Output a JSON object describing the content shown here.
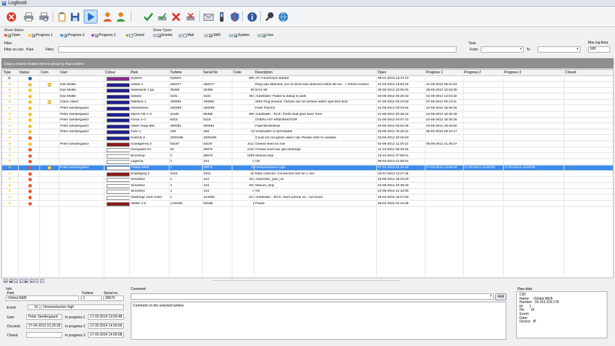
{
  "window": {
    "title": "Logbook"
  },
  "toolbar": {
    "buttons": [
      {
        "name": "close-icon",
        "color": "#d9342b"
      },
      {
        "name": "print-icon",
        "color": "#6b7380"
      },
      {
        "name": "print-preview-icon",
        "color": "#6b7380"
      },
      {
        "name": "clipboard-icon",
        "color": "#c8932b"
      },
      {
        "name": "save-icon",
        "color": "#2c5aa0"
      },
      {
        "name": "play-icon",
        "color": "#1f6fd1"
      },
      {
        "name": "user-icon",
        "color": "#e0892b"
      },
      {
        "name": "user-add-icon",
        "color": "#e0892b"
      },
      {
        "name": "acknowledge-check-icon",
        "color": "#2ba33a"
      },
      {
        "name": "acknowledge-all-icon",
        "color": "#6b7380"
      },
      {
        "name": "delete-x-icon",
        "color": "#d9342b"
      },
      {
        "name": "delete-all-icon",
        "color": "#6b7380"
      },
      {
        "name": "mail-icon",
        "color": "#6b7380"
      },
      {
        "name": "phone-icon",
        "color": "#3a3f47"
      },
      {
        "name": "shield-icon",
        "color": "#2c6fc7"
      },
      {
        "name": "info-icon",
        "color": "#2c5aa0"
      },
      {
        "name": "wrench-icon",
        "color": "#3a3f47"
      },
      {
        "name": "globe-icon",
        "color": "#2c7fc7"
      }
    ]
  },
  "show_status": {
    "title": "Show Status",
    "items": [
      {
        "label": "Open",
        "checked": true,
        "color": "#e8562a"
      },
      {
        "label": "Progress 1",
        "checked": true,
        "color": "#f2c12e"
      },
      {
        "label": "Progress 2",
        "checked": true,
        "color": "#3a8ee0"
      },
      {
        "label": "Progress 3",
        "checked": true,
        "color": "#a04fc8"
      },
      {
        "label": "Closed",
        "checked": false,
        "color": "#7bc043"
      }
    ]
  },
  "show_types": {
    "title": "Show Types",
    "items": [
      {
        "label": "Events",
        "checked": true
      },
      {
        "label": "Mail",
        "checked": false
      },
      {
        "label": "SMS",
        "checked": true
      },
      {
        "label": "System",
        "checked": true
      },
      {
        "label": "User",
        "checked": true
      }
    ]
  },
  "filter": {
    "title": "Filter",
    "on_row_label": "Filter on row:",
    "on_row_value": "Park",
    "filter_label": "Filter:",
    "filter_value": ""
  },
  "time": {
    "title": "Time",
    "from_label": "From",
    "from_value": "",
    "to_label": "To",
    "to_value": ""
  },
  "max_log": {
    "label": "Max log lines",
    "value": "500"
  },
  "group_hint": "Drag a column header here to group by that column",
  "columns": [
    "Type",
    "Status",
    "Com.",
    "User",
    "Colour",
    "Park",
    "Turbine",
    "Serial No",
    "Code",
    "Description",
    "Open",
    "Progress 1",
    "Progress 2",
    "Progress 3",
    "Closed"
  ],
  "rows": [
    {
      "status": "#2c5aa0",
      "type": "system",
      "user": "",
      "colour": "#8b2a8b",
      "park": "System",
      "turbine": "System",
      "serial": "",
      "code": "600",
      "desc": "AC Connection started",
      "open": "08-01-2010 13:47:13",
      "p1": "",
      "p2": "",
      "p3": "",
      "closed": "",
      "com": false
    },
    {
      "status": "#f2c12e",
      "type": "event",
      "user": "Dan Müller",
      "colour": "#1f1f8f",
      "park": "Ulsted 1",
      "turbine": "150377",
      "serial": "150377",
      "code": "",
      "desc": "Ring was detected, but no DCD was detected within 90 sec. -> Reset modem",
      "open": "21-02-2012 13:50:16",
      "p1": "21-06-2012 09:32:03",
      "p2": "",
      "p3": "",
      "closed": "",
      "com": true
    },
    {
      "status": "#f2c12e",
      "type": "event",
      "user": "Dan Müller",
      "colour": "#1f1f8f",
      "park": "Vadehavet 1 (p)",
      "turbine": "30456",
      "serial": "30456",
      "code": "89",
      "desc": "Error 89",
      "open": "26-05-2012 10:05:24",
      "p1": "28-05-2012 10:03:39",
      "p2": "",
      "p3": "",
      "closed": "",
      "com": false
    },
    {
      "status": "#f2c12e",
      "type": "event",
      "user": "Dan Müller",
      "colour": "#1f1f8f",
      "park": "Søsted",
      "turbine": "3181",
      "serial": "3181",
      "code": "404",
      "desc": "AutoDialer: Failed to dialup to park",
      "open": "02-06-2012 05:25:43",
      "p1": "02-06-2012 12:02:32",
      "p2": "",
      "p3": "",
      "closed": "",
      "com": false
    },
    {
      "status": "#f2c12e",
      "type": "event",
      "user": "Claus Vilsen",
      "colour": "#1f1f8f",
      "park": "Nakskov 1",
      "turbine": "150592",
      "serial": "150592",
      "code": "",
      "desc": "SMS Ping timeout, Turbine did not answer within specified time",
      "open": "07-06-2012 03:10:53",
      "p1": "07-06-2012 03:13:11",
      "p2": "",
      "p3": "",
      "closed": "",
      "com": true
    },
    {
      "status": "#f2c12e",
      "type": "event",
      "user": "Peter Søndergaard",
      "colour": "#1f1f8f",
      "park": "Hestehaven",
      "turbine": "150299",
      "serial": "150299",
      "code": "",
      "desc": "Fault Thermo",
      "open": "21-06-2012 03:03:54",
      "p1": "24-06-2012 15:46:16",
      "p2": "",
      "p3": "",
      "closed": "",
      "com": false
    },
    {
      "status": "#f2c12e",
      "type": "event",
      "user": "Peter Søndergaard",
      "colour": "#1f1f8f",
      "park": "Myers Hill 1+2",
      "turbine": "South",
      "serial": "66489",
      "code": "869",
      "desc": "AutoDialer - DCE: Pt100 fault gear bear. front",
      "open": "21-06-2012 20:36:14",
      "p1": "24-06-2012 15:46:18",
      "p2": "",
      "p3": "",
      "closed": "",
      "com": false
    },
    {
      "status": "#f2c12e",
      "type": "event",
      "user": "Peter Søndergaard",
      "colour": "#1f1f8f",
      "park": "Farsø 1+2",
      "turbine": "5315",
      "serial": "5315",
      "code": "",
      "desc": "OVERLAST KRØJEMOTOR",
      "open": "21-06-2012 04:07:41",
      "p1": "24-06-2012 15:46:25",
      "p2": "",
      "p3": "",
      "closed": "",
      "com": false
    },
    {
      "status": "#f2c12e",
      "type": "event",
      "user": "Peter Søndergaard",
      "colour": "#1f1f8f",
      "park": "Gåser Enge Øst",
      "turbine": "300051",
      "serial": "300051",
      "code": "",
      "desc": "Fault BreakWear",
      "open": "23-06-2012 03:03:45",
      "p1": "24-06-2012 15:45:50",
      "p2": "",
      "p3": "",
      "closed": "",
      "com": false
    },
    {
      "status": "#f2c12e",
      "type": "event",
      "user": "Peter Søndergaard",
      "colour": "#1f1f8f",
      "park": "Tuen 1",
      "turbine": "198",
      "serial": "198",
      "code": "41",
      "desc": "Vindmøllen er fjernstartet",
      "open": "23-06-2012 10:26:22",
      "p1": "05-02-2015 09:10:17",
      "p2": "",
      "p3": "",
      "closed": "",
      "com": false
    },
    {
      "status": "#e8562a",
      "type": "event",
      "user": "",
      "colour": "#1f1f8f",
      "park": "Kastrufi 3",
      "turbine": "1000198",
      "serial": "1000198",
      "code": "",
      "desc": "Could not recognize alarm call, Please refer to rawdata",
      "open": "23-06-2012 20:16:23",
      "p1": "",
      "p2": "",
      "p3": "",
      "closed": "",
      "com": false
    },
    {
      "status": "#f2c12e",
      "type": "event",
      "user": "Peter Søndergaard",
      "colour": "#8b1a1a",
      "park": "Grankjærvej 2",
      "turbine": "63197",
      "serial": "63197",
      "code": "4112",
      "desc": "Gearoil level too low",
      "open": "04-09-2012 11:20:12",
      "p1": "06-09-2012 21:46:27",
      "p2": "",
      "p3": "",
      "closed": "",
      "com": false
    },
    {
      "status": "#e8562a",
      "type": "event",
      "user": "",
      "colour": "#ffffff",
      "park": "Overgaard 2A",
      "turbine": "32",
      "serial": "28670",
      "code": "2123",
      "desc": "Grease level low, gen.bearings",
      "open": "12-10-2012 08:28:15",
      "p1": "",
      "p2": "",
      "p3": "",
      "closed": "",
      "com": false
    },
    {
      "status": "#e8562a",
      "type": "event",
      "user": "",
      "colour": "#ffffff",
      "park": "Bronstrup",
      "turbine": "2",
      "serial": "28670",
      "code": "1001",
      "desc": "Manual stop",
      "open": "13-10-2012 07:96:01",
      "p1": "",
      "p2": "",
      "p3": "",
      "closed": "",
      "com": false
    },
    {
      "status": "#e8562a",
      "type": "event",
      "user": "",
      "colour": "#ffffff",
      "park": "Lagervej",
      "turbine": "1",
      "serial": "234",
      "code": "0",
      "desc": "OK",
      "open": "08-04-2013 21:56:51",
      "p1": "",
      "p2": "",
      "p3": "",
      "closed": "",
      "com": false
    },
    {
      "status": "#e8562a",
      "type": "event",
      "user": "Peter Søndergaard",
      "colour": "#ffffff",
      "park": "Orbital WEB",
      "turbine": "1",
      "serial": "28670",
      "code": "16",
      "desc": "Overproduction high",
      "open": "27-04-2013 01:26:28",
      "p1": "17-03-2014 13:59:48",
      "p2": "17-03-2014 14:00:00",
      "p3": "17-03-2014 14:00:08",
      "closed": "",
      "com": true,
      "selected": true
    },
    {
      "status": "#e8562a",
      "type": "event",
      "user": "",
      "colour": "#8b1a1a",
      "park": "Kradsbjerg 2",
      "turbine": "2415",
      "serial": "2415",
      "code": "-20",
      "desc": "Data collector: Connection lost for 1 min.",
      "open": "03-07-2013 13:27:46",
      "p1": "",
      "p2": "",
      "p3": "",
      "closed": "",
      "com": false
    },
    {
      "status": "#e8562a",
      "type": "event",
      "user": "",
      "colour": "#ffffff",
      "park": "Simested",
      "turbine": "1",
      "serial": "123",
      "code": "410",
      "desc": "Automatic_yaw_cw",
      "open": "23-08-2014 19:33:20",
      "p1": "",
      "p2": "",
      "p3": "",
      "closed": "",
      "com": false
    },
    {
      "status": "#e8562a",
      "type": "event",
      "user": "",
      "colour": "#ffffff",
      "park": "Simested",
      "turbine": "1",
      "serial": "123",
      "code": "204",
      "desc": "Manuel_stop",
      "open": "23-08-2014 20:38:40",
      "p1": "",
      "p2": "",
      "p3": "",
      "closed": "",
      "com": false
    },
    {
      "status": "#e8562a",
      "type": "event",
      "user": "",
      "colour": "#ffffff",
      "park": "Simested",
      "turbine": "1",
      "serial": "123",
      "code": "0",
      "desc": "OK",
      "open": "23-08-2014 21:42:00",
      "p1": "",
      "p2": "",
      "p3": "",
      "closed": "",
      "com": false
    },
    {
      "status": "#e8562a",
      "type": "event",
      "user": "",
      "colour": "#ffffff",
      "park": "Gestenge John Holm",
      "turbine": "1",
      "serial": "123456",
      "code": "-413",
      "desc": "AutoDialer - RCS: Alarm phone no.. not found",
      "open": "25-02-2015 15:27:53",
      "p1": "",
      "p2": "",
      "p3": "",
      "closed": "",
      "com": false
    },
    {
      "status": "#e8562a",
      "type": "event",
      "user": "",
      "colour": "#8b1a1a",
      "park": "Albæk 1-5",
      "turbine": "1-63159",
      "serial": "63159",
      "code": "1",
      "desc": "Pause",
      "open": "26-02-2015 22:16:38",
      "p1": "",
      "p2": "",
      "p3": "",
      "closed": "",
      "com": false
    }
  ],
  "pager": [
    "⏮",
    "◀",
    "◁",
    "▷",
    "▶",
    "⏭",
    "+",
    "✓"
  ],
  "info": {
    "title": "Info",
    "park_label": "Park",
    "park_value": "Orbital WEB",
    "turbine_label": "Turbine",
    "turbine_value": "1",
    "serial_label": "Serial no.",
    "serial_value": "28670",
    "event_label": "Event",
    "event_code": "16",
    "event_text": "Overproduction high",
    "user_label": "User",
    "user_value": "Peter Søndergaard",
    "p1_label": "In progress 1",
    "p1_value": "17-03-2014 13:59:48",
    "occured_label": "Occured",
    "occured_value": "27-04-2013 01:26:28",
    "p2_label": "In progress 2",
    "p2_value": "17-03-2014 14:00:00",
    "closed_label": "Closed",
    "closed_value": "",
    "p3_label": "In progress 3",
    "p3_value": "17-03-2014 14:00:08"
  },
  "comment": {
    "title": "Comment",
    "select_value": "",
    "add_label": "Add",
    "text": "Comment on the selected turbine"
  },
  "raw": {
    "title": "Raw data",
    "text": "CID:\nName:    Orbital WEB\nNumber:  93.163.229.178\nId:      1\nNo:      16\nEvent:\nDate:\nDevice:  IP"
  }
}
